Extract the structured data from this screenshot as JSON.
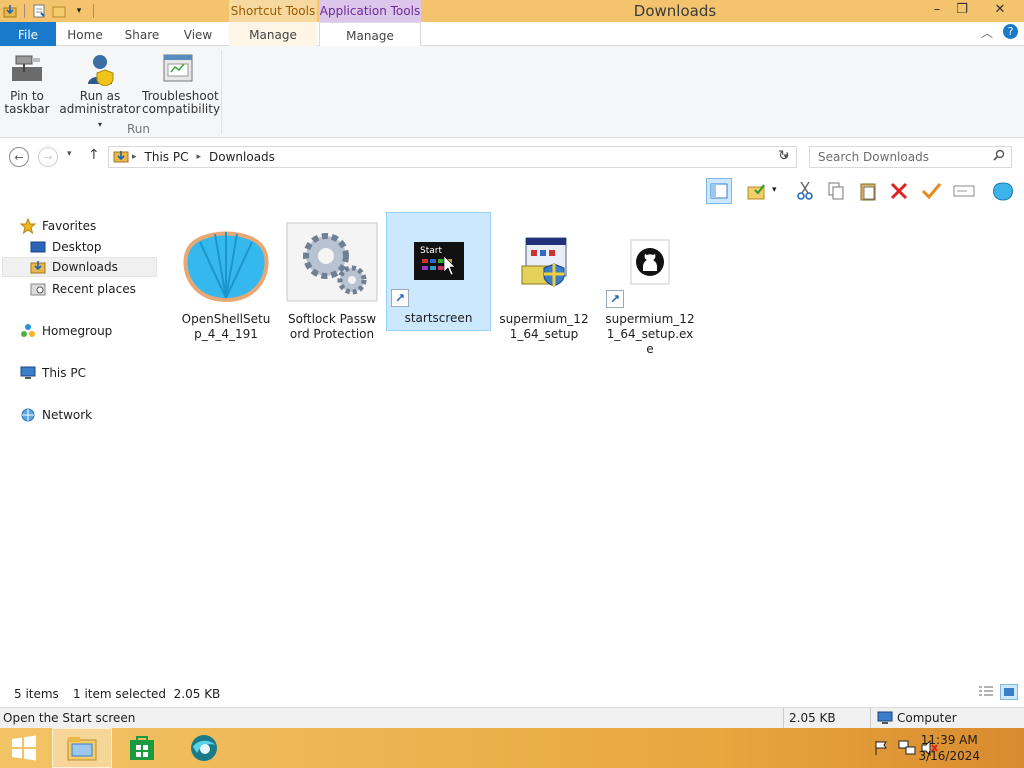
{
  "window": {
    "title": "Downloads",
    "context_tabs": {
      "shortcut_tools": "Shortcut Tools",
      "application_tools": "Application Tools"
    },
    "controls": {
      "minimize": "–",
      "restore": "❐",
      "close": "✕"
    }
  },
  "ribbon_tabs": {
    "file": "File",
    "home": "Home",
    "share": "Share",
    "view": "View",
    "manage_shortcut": "Manage",
    "manage_app": "Manage"
  },
  "ribbon": {
    "pin_label": "Pin to\ntaskbar",
    "run_admin_label": "Run as\nadministrator",
    "troubleshoot_label": "Troubleshoot\ncompatibility",
    "group_run": "Run"
  },
  "address": {
    "crumbs": [
      "This PC",
      "Downloads"
    ],
    "search_placeholder": "Search Downloads"
  },
  "nav": {
    "favorites": "Favorites",
    "desktop": "Desktop",
    "downloads": "Downloads",
    "recent_places": "Recent places",
    "homegroup": "Homegroup",
    "this_pc": "This PC",
    "network": "Network"
  },
  "files": [
    {
      "name": "OpenShellSetup_4_4_191",
      "icon": "openshell-icon",
      "shortcut": false,
      "selected": false
    },
    {
      "name": "Softlock Password Protection",
      "icon": "gears-icon",
      "shortcut": false,
      "selected": false
    },
    {
      "name": "startscreen",
      "icon": "startscreen-icon",
      "shortcut": true,
      "selected": true
    },
    {
      "name": "supermium_121_64_setup",
      "icon": "installer-icon",
      "shortcut": false,
      "selected": false
    },
    {
      "name": "supermium_121_64_setup.exe",
      "icon": "github-icon",
      "shortcut": true,
      "selected": false
    }
  ],
  "status": {
    "items": "5 items",
    "selected": "1 item selected  2.05 KB"
  },
  "details": {
    "description": "Open the Start screen",
    "size": "2.05 KB",
    "location": "Computer"
  },
  "taskbar": {
    "time": "11:39 AM",
    "date": "3/16/2024"
  },
  "colors": {
    "titlebar": "#f3c36d",
    "file_tab": "#1979ca",
    "selection": "#cce8ff"
  }
}
